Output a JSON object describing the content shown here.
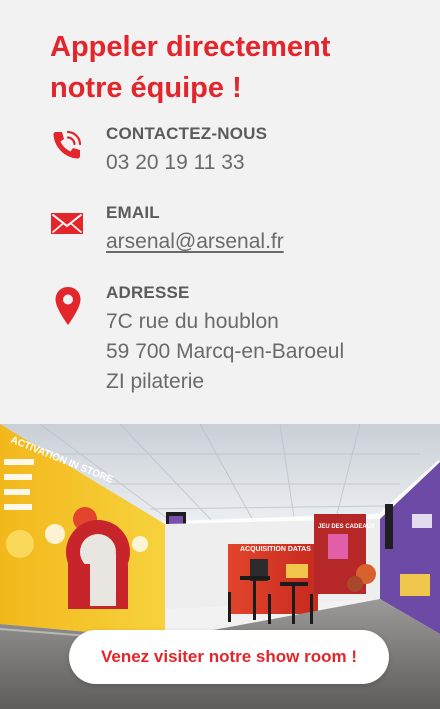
{
  "contact": {
    "headline": "Appeler directement notre équipe !",
    "phone": {
      "label": "CONTACTEZ-NOUS",
      "value": "03 20 19 11 33",
      "icon": "phone-icon"
    },
    "email": {
      "label": "EMAIL",
      "value": "arsenal@arsenal.fr",
      "icon": "envelope-icon"
    },
    "address": {
      "label": "ADRESSE",
      "lines": [
        "7C rue du houblon",
        "59 700 Marcq-en-Baroeul",
        "ZI pilaterie"
      ],
      "icon": "map-pin-icon"
    }
  },
  "showroom": {
    "sign_left": "ACTIVATION IN STORE",
    "sign_right": "ACQUISITION DATAS",
    "sign_booth": "JEU DES CADEAUX",
    "cta_label": "Venez visiter notre show room !"
  },
  "colors": {
    "accent": "#e3262c",
    "text": "#6a6a6a",
    "background": "#f2f2f2"
  }
}
